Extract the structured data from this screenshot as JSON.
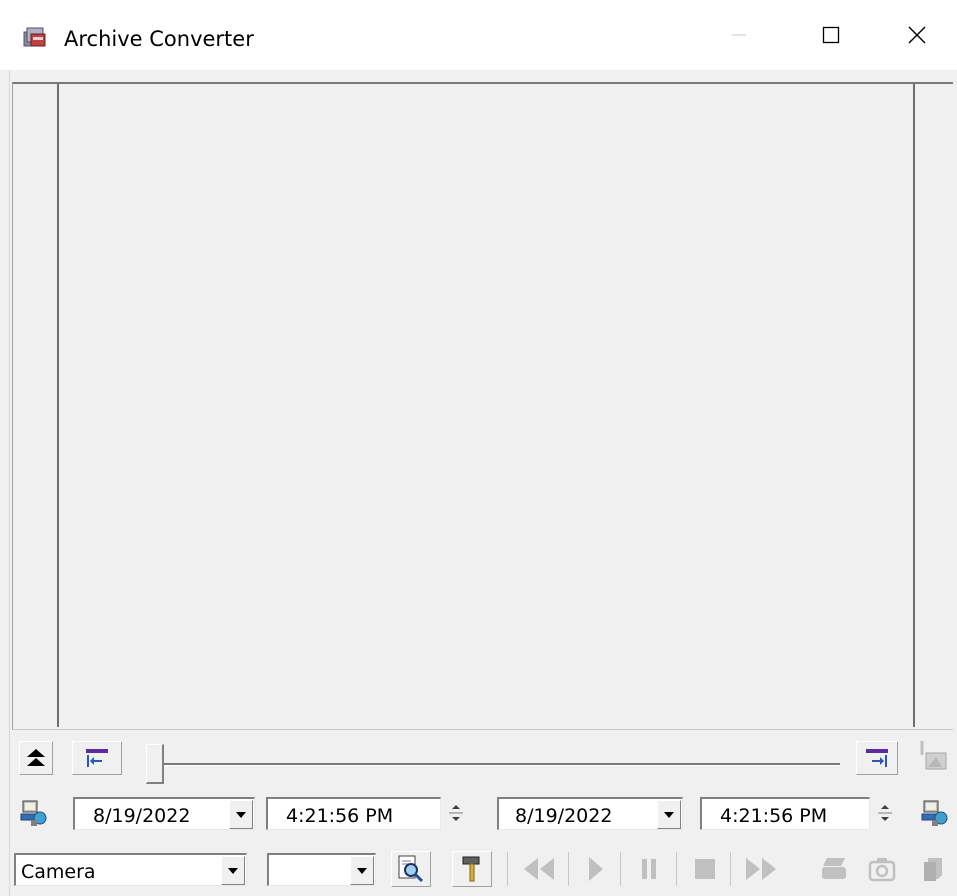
{
  "window": {
    "title": "Archive Converter",
    "icon": "archive-converter-app-icon",
    "controls": [
      "minimize-icon",
      "maximize-icon",
      "close-icon"
    ]
  },
  "toolbar_top": {
    "collapse_icon": "double-up-arrow-icon",
    "set_start_icon": "mark-start-icon",
    "set_end_icon": "mark-end-icon",
    "export_icon": "export-image-icon",
    "slider_position": 0
  },
  "time_range": {
    "connect_icon_left": "server-connect-icon",
    "start_date": "8/19/2022",
    "start_time": "4:21:56 PM",
    "end_date": "8/19/2022",
    "end_time": "4:21:56 PM",
    "connect_icon_right": "server-connect-icon"
  },
  "controls": {
    "source_select": "Camera",
    "second_select": "",
    "search_icon": "search-magnifier-icon",
    "settings_icon": "hammer-tools-icon",
    "playback": [
      "rewind-icon",
      "play-icon",
      "pause-icon",
      "stop-icon",
      "fast-forward-icon"
    ],
    "tools": [
      "print-icon",
      "snapshot-camera-icon",
      "copy-icon"
    ]
  },
  "colors": {
    "face": "#f0f0f0",
    "disabled_icon": "#c0c0c0",
    "accent_purple": "#5a2ca0",
    "accent_blue": "#2858b8"
  }
}
